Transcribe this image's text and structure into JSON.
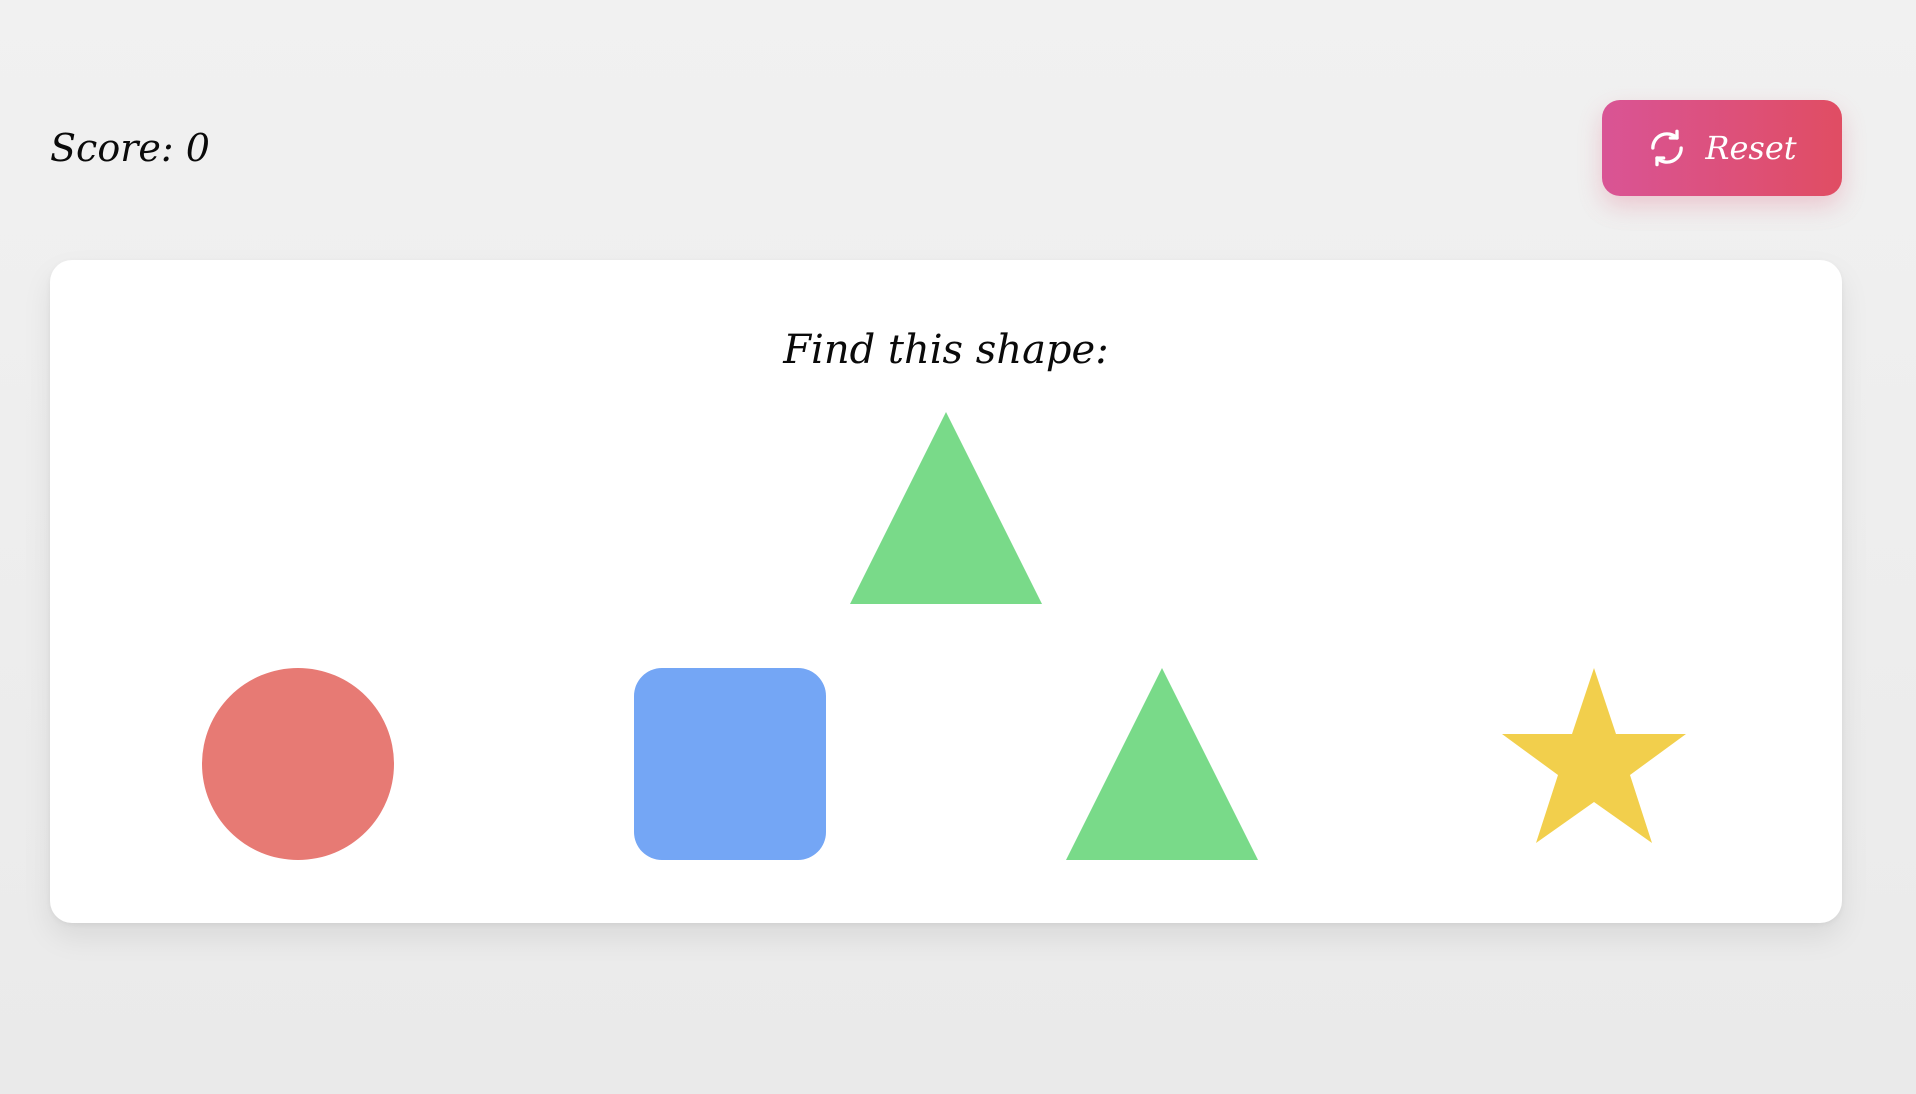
{
  "header": {
    "score_label": "Score: 0",
    "reset_label": "Reset",
    "reset_icon": "refresh-icon"
  },
  "game": {
    "prompt": "Find this shape:",
    "target_shape": "triangle",
    "options": [
      "circle",
      "square",
      "triangle",
      "star"
    ]
  },
  "colors": {
    "circle": "#e77a74",
    "square": "#74a6f5",
    "triangle": "#79da89",
    "star": "#f2cf4c",
    "reset_gradient_start": "#d95495",
    "reset_gradient_end": "#e04d63"
  }
}
